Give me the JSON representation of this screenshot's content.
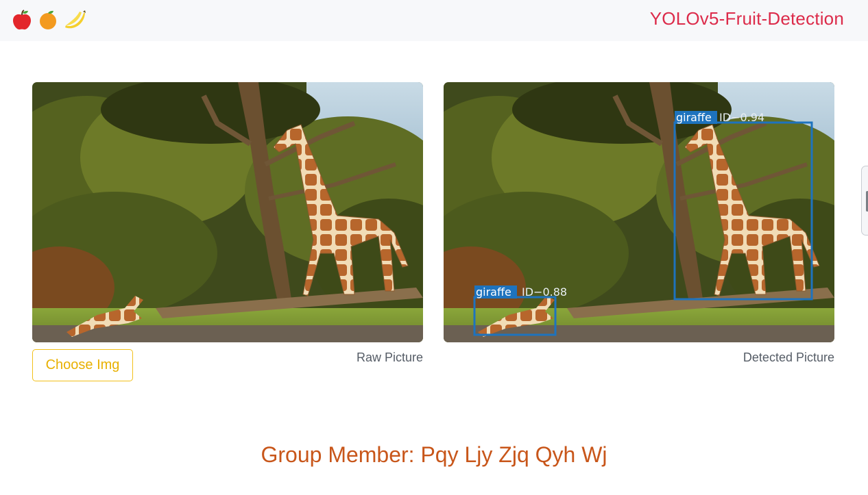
{
  "header": {
    "icons": [
      "apple-icon",
      "orange-icon",
      "banana-icon"
    ],
    "title": "YOLOv5-Fruit-Detection",
    "title_color": "#dc2b4a"
  },
  "panels": {
    "raw_caption": "Raw Picture",
    "detected_caption": "Detected Picture"
  },
  "detections": [
    {
      "class": "giraffe",
      "score_text": "ID−0.94"
    },
    {
      "class": "giraffe",
      "score_text": "ID−0.88"
    }
  ],
  "actions": {
    "choose_label": "Choose Img",
    "choose_color": "#f2c01a"
  },
  "footer": {
    "text": "Group Member: Pqy Ljy Zjq Qyh Wj",
    "color": "#c8561a"
  },
  "box_color": "#1e73be"
}
